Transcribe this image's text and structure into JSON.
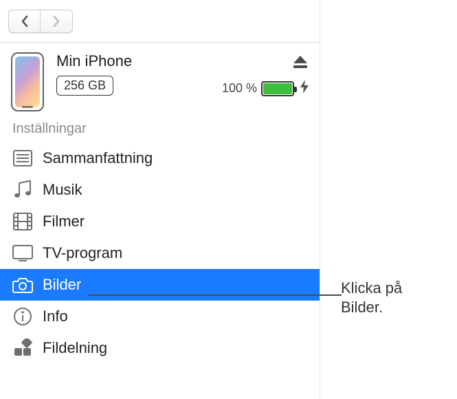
{
  "nav": {
    "back_enabled": true,
    "forward_enabled": false
  },
  "device": {
    "name": "Min iPhone",
    "capacity": "256 GB",
    "battery_pct": "100 %",
    "battery_level": 1.0,
    "charging": true
  },
  "section_header": "Inställningar",
  "sidebar": {
    "items": [
      {
        "id": "summary",
        "label": "Sammanfattning",
        "icon": "list",
        "selected": false
      },
      {
        "id": "music",
        "label": "Musik",
        "icon": "music-note",
        "selected": false
      },
      {
        "id": "movies",
        "label": "Filmer",
        "icon": "film",
        "selected": false
      },
      {
        "id": "tv",
        "label": "TV-program",
        "icon": "tv",
        "selected": false
      },
      {
        "id": "photos",
        "label": "Bilder",
        "icon": "camera",
        "selected": true
      },
      {
        "id": "info",
        "label": "Info",
        "icon": "info",
        "selected": false
      },
      {
        "id": "file-sharing",
        "label": "Fildelning",
        "icon": "apps",
        "selected": false
      }
    ]
  },
  "callout": {
    "line1": "Klicka på",
    "line2": "Bilder."
  }
}
